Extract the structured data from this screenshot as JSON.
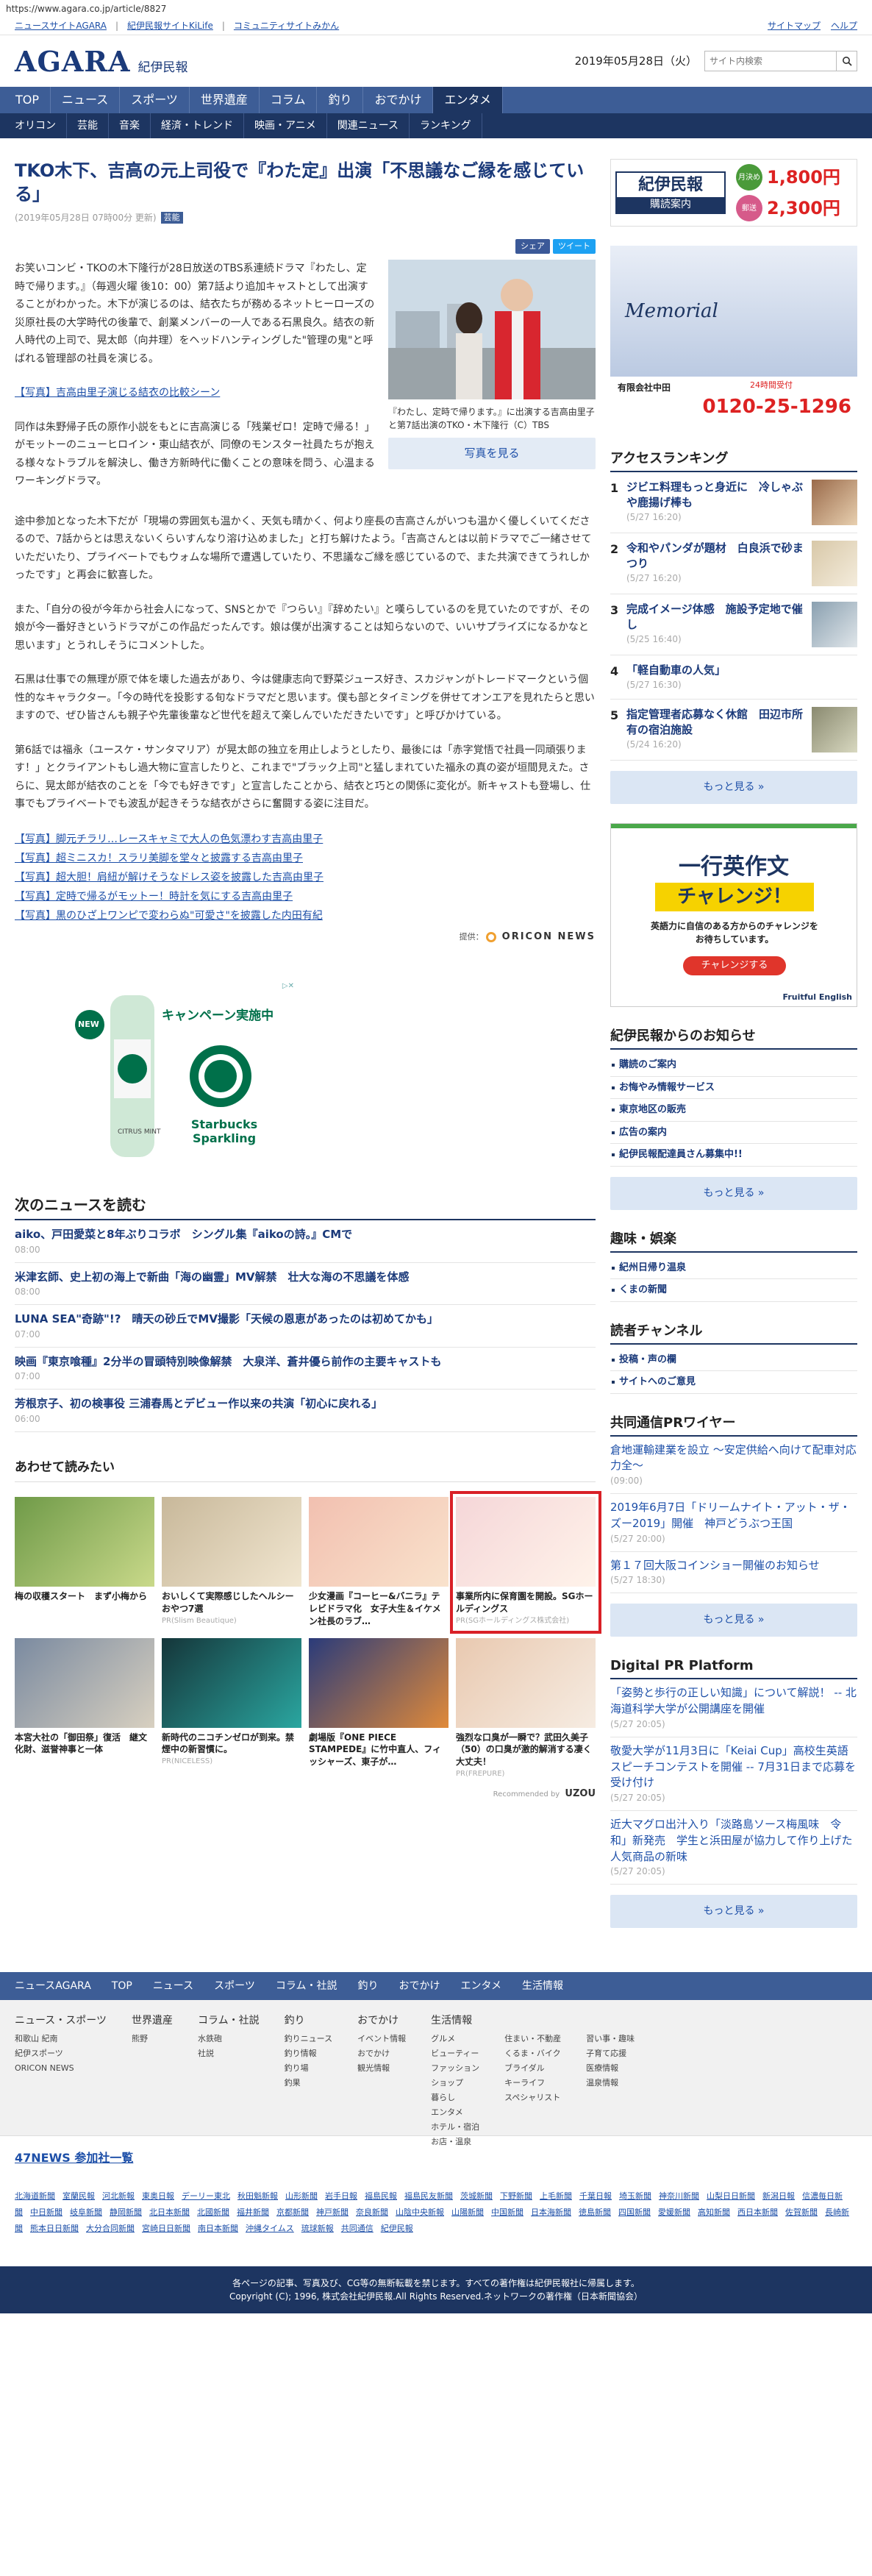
{
  "url": "https://www.agara.co.jp/article/8827",
  "top_links": [
    "ニュースサイトAGARA",
    "紀伊民報サイトKiLife",
    "コミュニティサイトみかん"
  ],
  "top_right": [
    "サイトマップ",
    "ヘルプ"
  ],
  "logo": {
    "en": "AGARA",
    "ja": "紀伊民報"
  },
  "date": "2019年05月28日（火）",
  "search_placeholder": "サイト内検索",
  "nav1": [
    "TOP",
    "ニュース",
    "スポーツ",
    "世界遺産",
    "コラム",
    "釣り",
    "おでかけ",
    "エンタメ"
  ],
  "nav2": [
    "オリコン",
    "芸能",
    "音楽",
    "経済・トレンド",
    "映画・アニメ",
    "関連ニュース",
    "ランキング"
  ],
  "article": {
    "title": "TKO木下、吉高の元上司役で『わた定』出演「不思議なご縁を感じている」",
    "meta": "(2019年05月28日 07時00分 更新)",
    "tag": "芸能",
    "share_fb": "シェア",
    "share_tw": "ツイート",
    "p1": "お笑いコンビ・TKOの木下隆行が28日放送のTBS系連続ドラマ『わたし、定時で帰ります。』（毎週火曜 後10：00）第7話より追加キャストとして出演することがわかった。木下が演じるのは、結衣たちが務めるネットヒーローズの災原社長の大学時代の後輩で、創業メンバーの一人である石黒良久。結衣の新人時代の上司で、晃太郎（向井理）をヘッドハンティングした\"管理の鬼\"と呼ばれる管理部の社員を演じる。",
    "link1": "【写真】吉高由里子演じる結衣の比較シーン",
    "p2": "同作は朱野帰子氏の原作小説をもとに吉高演じる「残業ゼロ！定時で帰る！」がモットーのニューヒロイン・東山結衣が、同僚のモンスター社員たちが抱える様々なトラブルを解決し、働き方新時代に働くことの意味を問う、心温まるワーキングドラマ。",
    "p3": "途中参加となった木下だが「現場の雰囲気も温かく、天気も晴かく、何より座長の吉高さんがいつも温かく優しくいてくださるので、7話からとは思えないくらいすんなり溶け込めました」と打ち解けたよう。「吉高さんとは以前ドラマでご一緒させていただいたり、プライベートでもウォムな場所で遭遇していたり、不思議なご縁を感じているので、また共演できてうれしかったです」と再会に歓喜した。",
    "p4": "また、「自分の役が今年から社会人になって、SNSとかで『つらい』『辞めたい』と嘆らしているのを見ていたのですが、その娘が今一番好きというドラマがこの作品だったんです。娘は僕が出演することは知らないので、いいサプライズになるかなと思います」とうれしそうにコメントした。",
    "p5": "石黒は仕事での無理が原で体を壊した過去があり、今は健康志向で野菜ジュース好き、スカジャンがトレードマークという個性的なキャラクター。「今の時代を投影する旬なドラマだと思います。僕も部とタイミングを併せてオンエアを見れたらと思いますので、ぜひ皆さんも親子や先輩後輩など世代を超えて楽しんでいただきたいです」と呼びかけている。",
    "p6": "第6話では福永（ユースケ・サンタマリア）が晃太郎の独立を用止しようとしたり、最後には「赤字覚悟で社員一同頑張ります！」とクライアントもし過大物に宣言したりと、これまで\"ブラック上司\"と猛しまれていた福永の真の姿が垣間見えた。さらに、晃太郎が結衣のことを「今でも好きです」と宣言したことから、結衣と巧との関係に変化が。新キャストも登場し、仕事でもプライベートでも波乱が起きそうな結衣がさらに奮闘する姿に注目だ。",
    "related": [
      "【写真】脚元チラリ…レースキャミで大人の色気漂わす吉高由里子",
      "【写真】超ミニスカ！スラリ美脚を堂々と披露する吉高由里子",
      "【写真】超大胆！肩紐が解けそうなドレス姿を披露した吉高由里子",
      "【写真】定時で帰るがモットー！時計を気にする吉高由里子",
      "【写真】黒のひざ上ワンピで変わらぬ\"可愛さ\"を披露した内田有紀"
    ],
    "photo_caption": "『わたし、定時で帰ります。』に出演する吉高由里子と第7話出演のTKO・木下隆行（C）TBS",
    "photo_button": "写真を見る",
    "credit": "提供：",
    "credit_logo": "ORICON NEWS"
  },
  "ad1": {
    "badge": "NEW",
    "headline": "キャンペーン実施中",
    "brand": "Starbucks Sparkling",
    "sub": "CITRUS MINT"
  },
  "next_news": {
    "title": "次のニュースを読む",
    "items": [
      {
        "title": "aiko、戸田愛菜と8年ぶりコラボ　シングル集『aikoの詩。』CMで",
        "time": "08:00"
      },
      {
        "title": "米津玄師、史上初の海上で新曲「海の幽霊」MV解禁　壮大な海の不思議を体感",
        "time": "08:00"
      },
      {
        "title": "LUNA SEA\"奇跡\"!?　晴天の砂丘でMV撮影「天候の恩恵があったのは初めてかも」",
        "time": "07:00"
      },
      {
        "title": "映画『東京喰種』2分半の冒頭特別映像解禁　大泉洋、蒼井優ら前作の主要キャストも",
        "time": "07:00"
      },
      {
        "title": "芳根京子、初の検事役 三浦春馬とデビュー作以来の共演「初心に戻れる」",
        "time": "06:00"
      }
    ]
  },
  "also": {
    "title": "あわせて読みたい",
    "cards": [
      {
        "title": "梅の収穫スタート　まず小梅から",
        "pr": ""
      },
      {
        "title": "おいしくて実際感じしたヘルシーおやつ7選",
        "pr": "PR(Slism Beautique)"
      },
      {
        "title": "少女漫画『コーヒー&バニラ』テレビドラマ化　女子大生＆イケメン社長のラブ…",
        "pr": ""
      },
      {
        "title": "事業所内に保育園を開設。SGホールディングス",
        "pr": "PR(SGホールディングス株式会社)"
      },
      {
        "title": "本宮大社の「御田祭」復活　継文化財、滋誉神事と一体",
        "pr": ""
      },
      {
        "title": "新時代のニコチンゼロが到来。禁煙中の新習慣に。",
        "pr": "PR(NICELESS)"
      },
      {
        "title": "劇場版『ONE PIECE STAMPEDE』に竹中直人、フィッシャーズ、東子が…",
        "pr": ""
      },
      {
        "title": "強烈な口臭が一瞬で？武田久美子（50）の口臭が激的解消する凄く大丈夫！",
        "pr": "PR(FREPURE)"
      }
    ],
    "recommended": "Recommended by",
    "rec_logo": "UZOU"
  },
  "side": {
    "banner": {
      "brand": "紀伊民報",
      "sub": "購読案内",
      "label1": "月決め",
      "price1": "1,800円",
      "label2": "郵送",
      "price2": "2,300円"
    },
    "ad": {
      "title": "Memorial",
      "sub": "24時間受付",
      "tel": "0120-25-1296",
      "company": "有限会社中田"
    },
    "ranking": {
      "title": "アクセスランキング",
      "items": [
        {
          "title": "ジビエ料理もっと身近に　冷しゃぶや鹿揚げ棒も",
          "time": "(5/27 16:20)"
        },
        {
          "title": "令和やパンダが題材　白良浜で砂まつり",
          "time": "(5/27 16:20)"
        },
        {
          "title": "完成イメージ体感　施設予定地で催し",
          "time": "(5/25 16:40)"
        },
        {
          "title": "「軽自動車の人気」",
          "time": "(5/27 16:30)"
        },
        {
          "title": "指定管理者応募なく休館　田辺市所有の宿泊施設",
          "time": "(5/24 16:20)"
        }
      ],
      "more": "もっと見る »"
    },
    "eiad": {
      "line1": "一行英作文",
      "line2": "チャレンジ！",
      "sub": "英語力に自信のある方からのチャレンジをお待ちしています。",
      "btn": "チャレンジする",
      "brand": "Fruitful English"
    },
    "notice": {
      "title": "紀伊民報からのお知らせ",
      "items": [
        "購読のご案内",
        "お悔やみ情報サービス",
        "東京地区の販売",
        "広告の案内",
        "紀伊民報配達員さん募集中!!"
      ],
      "more": "もっと見る »"
    },
    "hobby": {
      "title": "趣味・娯楽",
      "items": [
        "紀州日帰り温泉",
        "くまの新聞"
      ]
    },
    "reader": {
      "title": "読者チャンネル",
      "items": [
        "投稿・声の欄",
        "サイトへのご意見"
      ]
    },
    "wire": {
      "title": "共同通信PRワイヤー",
      "items": [
        {
          "title": "倉地運輸建業を設立 ～安定供給へ向けて配車対応力全～",
          "time": "(09:00)"
        },
        {
          "title": "2019年6月7日「ドリームナイト・アット・ザ・ズー2019」開催　神戸どうぶつ王国",
          "time": "(5/27 20:00)"
        },
        {
          "title": "第１７回大阪コインショー開催のお知らせ",
          "time": "(5/27 18:30)"
        }
      ],
      "more": "もっと見る »"
    },
    "dpr": {
      "title": "Digital PR Platform",
      "items": [
        {
          "title": "「姿勢と歩行の正しい知識」について解説！ -- 北海道科学大学が公開講座を開催",
          "time": "(5/27 20:05)"
        },
        {
          "title": "敬愛大学が11月3日に「Keiai Cup」高校生英語スピーチコンテストを開催 -- 7月31日まで応募を受け付け",
          "time": "(5/27 20:05)"
        },
        {
          "title": "近大マグロ出汁入り「淡路島ソース梅風味　令和」新発売　学生と浜田屋が協力して作り上げた人気商品の新味",
          "time": "(5/27 20:05)"
        }
      ],
      "more": "もっと見る »"
    }
  },
  "footer": {
    "nav": [
      "ニュースAGARA",
      "TOP",
      "ニュース",
      "スポーツ",
      "コラム・社説",
      "釣り",
      "おでかけ",
      "エンタメ",
      "生活情報"
    ],
    "cols": [
      {
        "h": "ニュース・スポーツ",
        "items": [
          "和歌山 紀南",
          "紀伊スポーツ",
          "ORICON NEWS"
        ]
      },
      {
        "h": "世界遺産",
        "items": [
          "熊野"
        ]
      },
      {
        "h": "コラム・社説",
        "items": [
          "水鉄砲",
          "社説"
        ]
      },
      {
        "h": "釣り",
        "items": [
          "釣りニュース",
          "釣り情報",
          "釣り場",
          "釣果"
        ]
      },
      {
        "h": "おでかけ",
        "items": [
          "イベント情報",
          "おでかけ",
          "観光情報"
        ]
      },
      {
        "h": "生活情報",
        "items": [
          "グルメ",
          "ビューティー",
          "ファッション",
          "ショップ",
          "暮らし",
          "エンタメ",
          "ホテル・宿泊",
          "お店・温泉"
        ]
      },
      {
        "h": "",
        "items": [
          "住まい・不動産",
          "くるま・バイク",
          "ブライダル",
          "キーライフ",
          "スペシャリスト"
        ]
      },
      {
        "h": "",
        "items": [
          "習い事・趣味",
          "子育て応援",
          "医療情報",
          "温泉情報"
        ]
      }
    ],
    "net47": "47NEWS 参加社一覧",
    "papers": [
      "北海道新聞",
      "室蘭民報",
      "河北新報",
      "東奥日報",
      "デーリー東北",
      "秋田魁新報",
      "山形新聞",
      "岩手日報",
      "福島民報",
      "福島民友新聞",
      "茨城新聞",
      "下野新聞",
      "上毛新聞",
      "千葉日報",
      "埼玉新聞",
      "神奈川新聞",
      "山梨日日新聞",
      "新潟日報",
      "信濃毎日新聞",
      "中日新聞",
      "岐阜新聞",
      "静岡新聞",
      "北日本新聞",
      "北國新聞",
      "福井新聞",
      "京都新聞",
      "神戸新聞",
      "奈良新聞",
      "山陰中央新報",
      "山陽新聞",
      "中国新聞",
      "日本海新聞",
      "徳島新聞",
      "四国新聞",
      "愛媛新聞",
      "高知新聞",
      "西日本新聞",
      "佐賀新聞",
      "長崎新聞",
      "熊本日日新聞",
      "大分合同新聞",
      "宮崎日日新聞",
      "南日本新聞",
      "沖縄タイムス",
      "琉球新報",
      "共同通信",
      "紀伊民報"
    ],
    "copy1": "各ページの記事、写真及び、CG等の無断転載を禁じます。すべての著作権は紀伊民報社に帰属します。",
    "copy2": "Copyright (C); 1996, 株式会社紀伊民報.All Rights Reserved.ネットワークの著作権（日本新聞協会）"
  }
}
